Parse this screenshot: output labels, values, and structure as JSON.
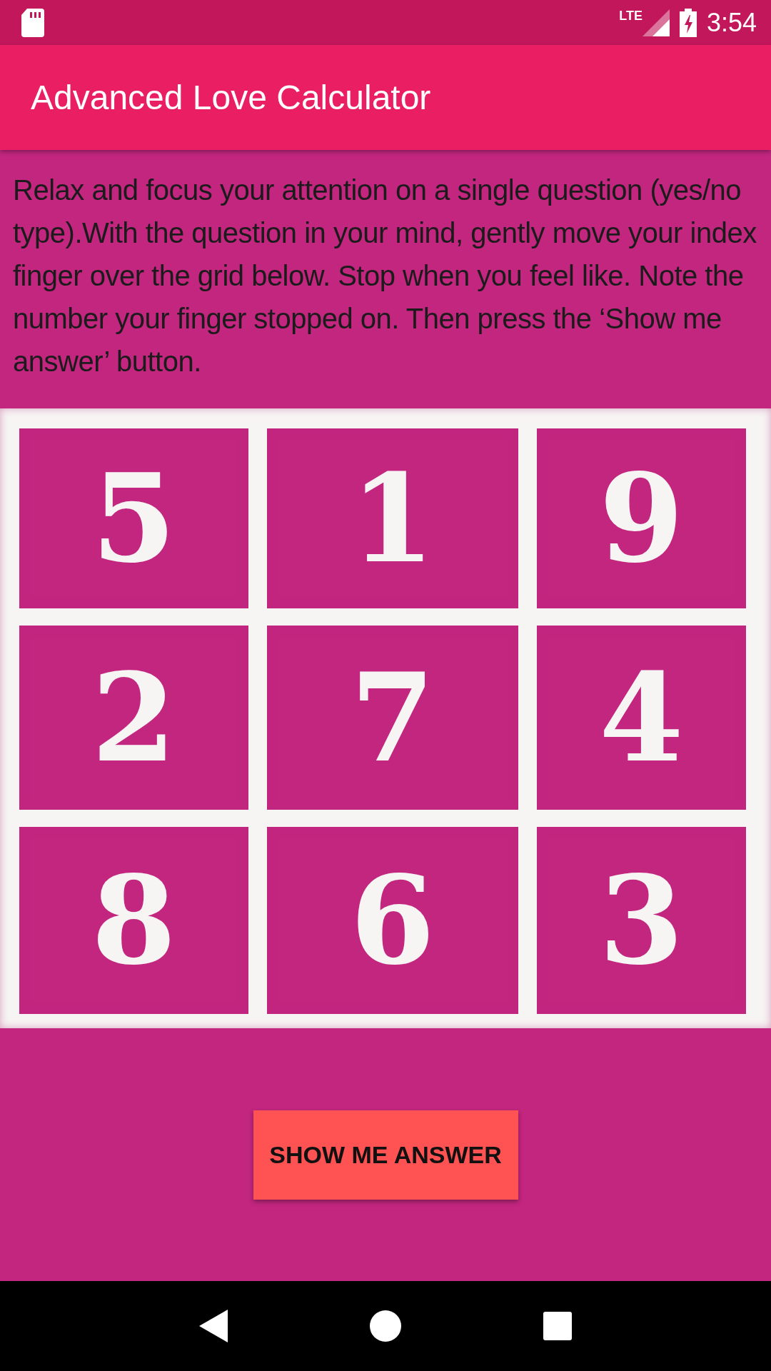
{
  "status_bar": {
    "network": "LTE",
    "time": "3:54"
  },
  "app_bar": {
    "title": "Advanced Love Calculator"
  },
  "instructions": "Relax and focus your attention on a single question (yes/no type).With the question in your mind, gently move your index finger over the grid below. Stop when you feel like. Note the number your finger stopped on.  Then press the ‘Show me answer’ button.",
  "grid": [
    [
      "5",
      "1",
      "9"
    ],
    [
      "2",
      "7",
      "4"
    ],
    [
      "8",
      "6",
      "3"
    ]
  ],
  "button": {
    "label": "SHOW ME ANSWER"
  }
}
